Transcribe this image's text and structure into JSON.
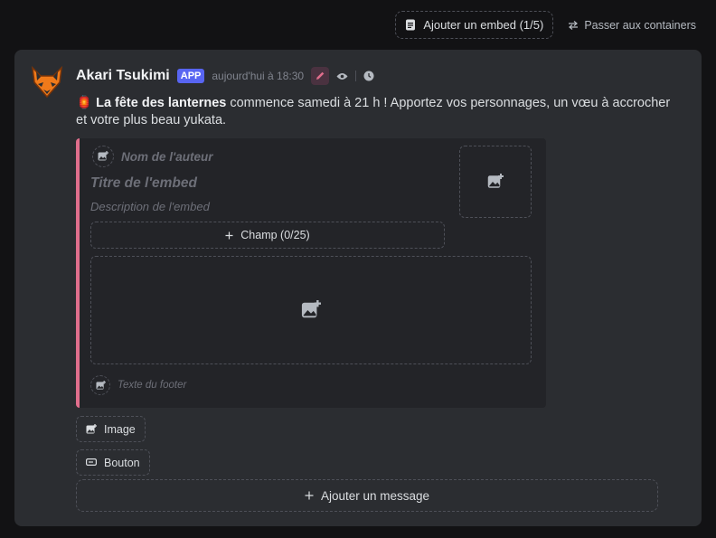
{
  "topbar": {
    "add_embed_label": "Ajouter un embed (1/5)",
    "switch_label": "Passer aux containers"
  },
  "message": {
    "username": "Akari Tsukimi",
    "badge": "APP",
    "timestamp": "aujourd'hui à 18:30",
    "emoji": "🏮",
    "text_bold": "La fête des lanternes",
    "text_rest": " commence samedi à 21 h ! Apportez vos personnages, un vœu à accrocher et votre plus beau yukata."
  },
  "embed": {
    "accent_color": "#e06e8c",
    "author_placeholder": "Nom de l'auteur",
    "title_placeholder": "Titre de l'embed",
    "description_placeholder": "Description de l'embed",
    "field_button": "Champ (0/25)",
    "footer_placeholder": "Texte du footer"
  },
  "actions": {
    "image_label": "Image",
    "button_label": "Bouton",
    "add_message_label": "Ajouter un message"
  },
  "colors": {
    "brand": "#5865f2",
    "avatar_orange": "#f07a1a"
  }
}
